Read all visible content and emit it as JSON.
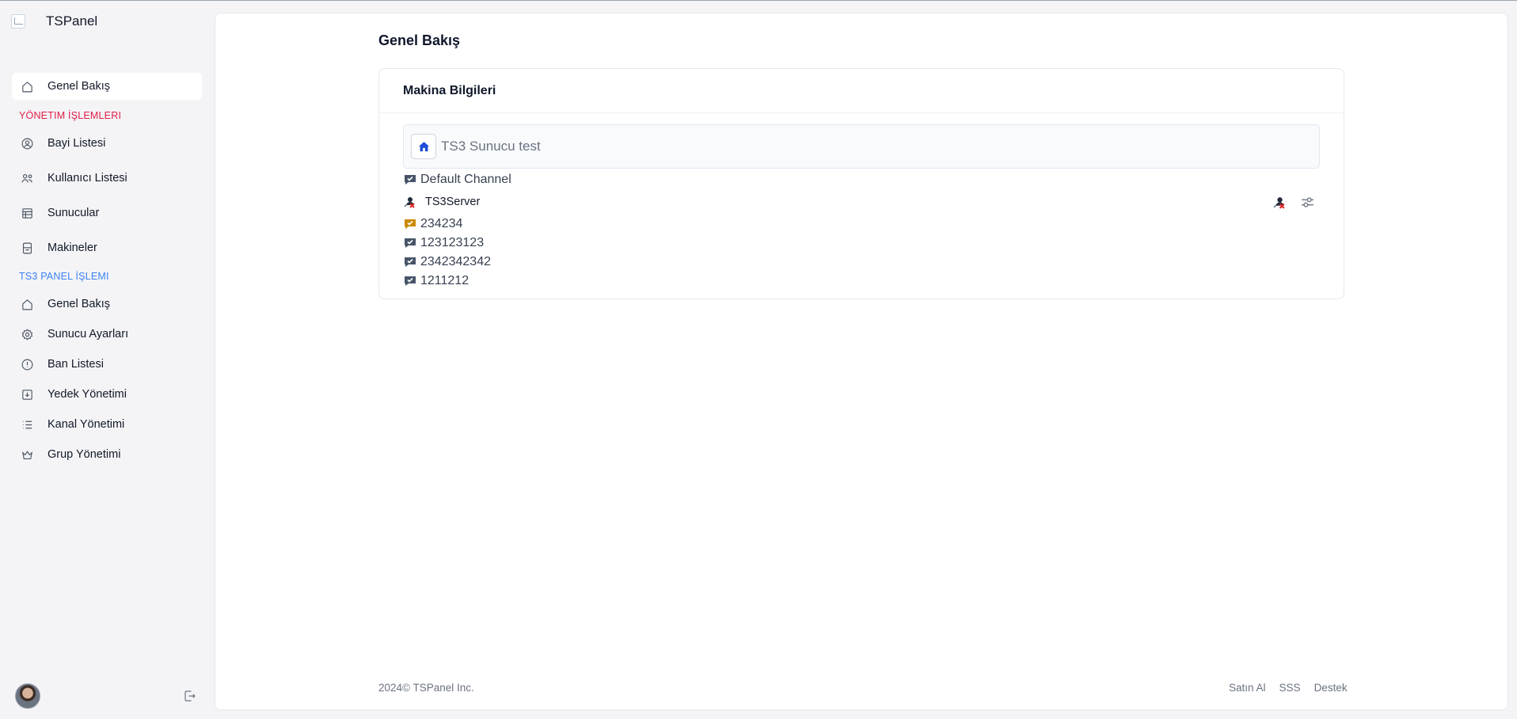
{
  "brand": {
    "name": "TSPanel"
  },
  "sidebar": {
    "top_item": {
      "label": "Genel Bakış",
      "icon": "home-icon"
    },
    "section_admin": {
      "title": "YÖNETIM İŞLEMLERI",
      "color": "#e11d48"
    },
    "admin_items": [
      {
        "label": "Bayi Listesi",
        "icon": "user-circle-icon"
      },
      {
        "label": "Kullanıcı Listesi",
        "icon": "users-icon"
      },
      {
        "label": "Sunucular",
        "icon": "server-layout-icon"
      },
      {
        "label": "Makineler",
        "icon": "machine-icon"
      }
    ],
    "section_ts3": {
      "title": "TS3 PANEL İŞLEMI",
      "color": "#3b82f6"
    },
    "ts3_items": [
      {
        "label": "Genel Bakış",
        "icon": "home-icon"
      },
      {
        "label": "Sunucu Ayarları",
        "icon": "gear-icon"
      },
      {
        "label": "Ban Listesi",
        "icon": "ban-icon"
      },
      {
        "label": "Yedek Yönetimi",
        "icon": "backup-icon"
      },
      {
        "label": "Kanal Yönetimi",
        "icon": "list-icon"
      },
      {
        "label": "Grup Yönetimi",
        "icon": "crown-icon"
      }
    ]
  },
  "main": {
    "page_title": "Genel Bakış",
    "card": {
      "title": "Makina Bilgileri",
      "server_name": "TS3 Sunucu test",
      "channels_before": [
        "Default Channel"
      ],
      "server_user": "TS3Server",
      "channels_after": [
        {
          "name": "234234",
          "color": "#ca8a04"
        },
        {
          "name": "123123123",
          "color": "#475569"
        },
        {
          "name": "2342342342",
          "color": "#475569"
        },
        {
          "name": "1211212",
          "color": "#475569"
        }
      ]
    }
  },
  "footer": {
    "copyright": "2024©",
    "company": "TSPanel Inc.",
    "links": [
      "Satın Al",
      "SSS",
      "Destek"
    ]
  }
}
